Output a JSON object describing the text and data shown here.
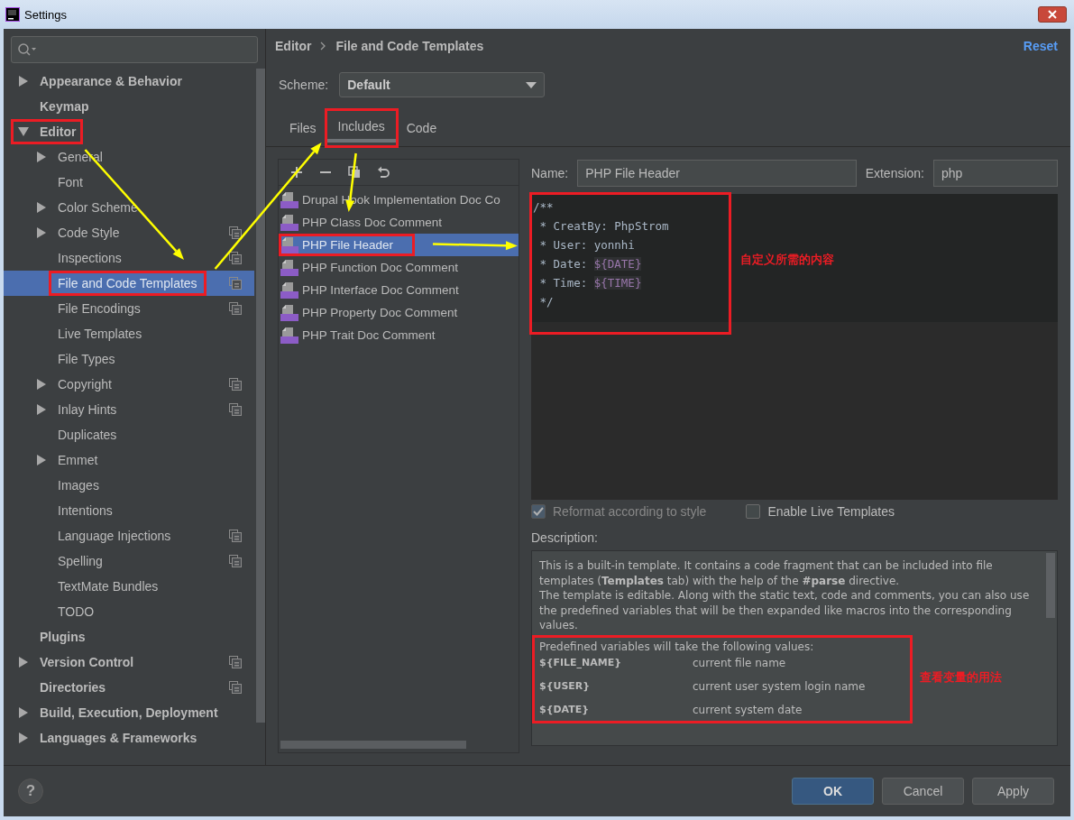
{
  "window": {
    "title": "Settings"
  },
  "sidebar": {
    "tree": [
      {
        "label": "Appearance & Behavior",
        "kind": "branch",
        "expanded": false,
        "selected": false,
        "project_level": false
      },
      {
        "label": "Keymap",
        "kind": "leaf",
        "selected": false,
        "project_level": false
      },
      {
        "label": "Editor",
        "kind": "branch",
        "expanded": true,
        "selected": false,
        "project_level": false,
        "children": [
          {
            "label": "General",
            "kind": "branch",
            "expanded": false,
            "selected": false,
            "project_level": false
          },
          {
            "label": "Font",
            "kind": "leaf",
            "selected": false,
            "project_level": false
          },
          {
            "label": "Color Scheme",
            "kind": "branch",
            "expanded": false,
            "selected": false,
            "project_level": false
          },
          {
            "label": "Code Style",
            "kind": "branch",
            "expanded": false,
            "selected": false,
            "project_level": true
          },
          {
            "label": "Inspections",
            "kind": "leaf",
            "selected": false,
            "project_level": true
          },
          {
            "label": "File and Code Templates",
            "kind": "leaf",
            "selected": true,
            "project_level": true
          },
          {
            "label": "File Encodings",
            "kind": "leaf",
            "selected": false,
            "project_level": true
          },
          {
            "label": "Live Templates",
            "kind": "leaf",
            "selected": false,
            "project_level": false
          },
          {
            "label": "File Types",
            "kind": "leaf",
            "selected": false,
            "project_level": false
          },
          {
            "label": "Copyright",
            "kind": "branch",
            "expanded": false,
            "selected": false,
            "project_level": true
          },
          {
            "label": "Inlay Hints",
            "kind": "branch",
            "expanded": false,
            "selected": false,
            "project_level": true
          },
          {
            "label": "Duplicates",
            "kind": "leaf",
            "selected": false,
            "project_level": false
          },
          {
            "label": "Emmet",
            "kind": "branch",
            "expanded": false,
            "selected": false,
            "project_level": false
          },
          {
            "label": "Images",
            "kind": "leaf",
            "selected": false,
            "project_level": false
          },
          {
            "label": "Intentions",
            "kind": "leaf",
            "selected": false,
            "project_level": false
          },
          {
            "label": "Language Injections",
            "kind": "leaf",
            "selected": false,
            "project_level": true
          },
          {
            "label": "Spelling",
            "kind": "leaf",
            "selected": false,
            "project_level": true
          },
          {
            "label": "TextMate Bundles",
            "kind": "leaf",
            "selected": false,
            "project_level": false
          },
          {
            "label": "TODO",
            "kind": "leaf",
            "selected": false,
            "project_level": false
          }
        ]
      },
      {
        "label": "Plugins",
        "kind": "leaf",
        "selected": false,
        "project_level": false
      },
      {
        "label": "Version Control",
        "kind": "branch",
        "expanded": false,
        "selected": false,
        "project_level": true
      },
      {
        "label": "Directories",
        "kind": "leaf",
        "selected": false,
        "project_level": true
      },
      {
        "label": "Build, Execution, Deployment",
        "kind": "branch",
        "expanded": false,
        "selected": false,
        "project_level": false
      },
      {
        "label": "Languages & Frameworks",
        "kind": "branch",
        "expanded": false,
        "selected": false,
        "project_level": false
      }
    ]
  },
  "breadcrumb": [
    "Editor",
    "File and Code Templates"
  ],
  "reset_link": "Reset",
  "scheme": {
    "label": "Scheme:",
    "value": "Default"
  },
  "tabs": [
    {
      "label": "Files",
      "selected": false
    },
    {
      "label": "Includes",
      "selected": true
    },
    {
      "label": "Code",
      "selected": false
    }
  ],
  "templates": [
    {
      "label": "Drupal Hook Implementation Doc Co",
      "selected": false
    },
    {
      "label": "PHP Class Doc Comment",
      "selected": false
    },
    {
      "label": "PHP File Header",
      "selected": true
    },
    {
      "label": "PHP Function Doc Comment",
      "selected": false
    },
    {
      "label": "PHP Interface Doc Comment",
      "selected": false
    },
    {
      "label": "PHP Property Doc Comment",
      "selected": false
    },
    {
      "label": "PHP Trait Doc Comment",
      "selected": false
    }
  ],
  "name_field": {
    "label": "Name:",
    "value": "PHP File Header"
  },
  "extension_field": {
    "label": "Extension:",
    "value": "php"
  },
  "code": [
    [
      {
        "text": "/**",
        "kind": "plain"
      }
    ],
    [
      {
        "text": " * CreatBy: PhpStrom",
        "kind": "plain"
      }
    ],
    [
      {
        "text": " * User: yonnhi",
        "kind": "plain"
      }
    ],
    [
      {
        "text": " * Date: ",
        "kind": "plain"
      },
      {
        "text": "${DATE}",
        "kind": "variable"
      }
    ],
    [
      {
        "text": " * Time: ",
        "kind": "plain"
      },
      {
        "text": "${TIME}",
        "kind": "variable"
      }
    ],
    [
      {
        "text": " */",
        "kind": "plain"
      }
    ]
  ],
  "options": [
    {
      "label": "Reformat according to style",
      "checked": true,
      "disabled": true
    },
    {
      "label": "Enable Live Templates",
      "checked": false,
      "disabled": false
    }
  ],
  "description": {
    "label": "Description:",
    "paragraphs": [
      "This is a built-in template. It contains a code fragment that can be included into file templates (**Templates** tab) with the help of the **#parse** directive.",
      "The template is editable. Along with the static text, code and comments, you can also use the predefined variables that will be then expanded like macros into the corresponding values."
    ],
    "variables_intro": "Predefined variables will take the following values:",
    "variables": [
      {
        "name": "${FILE_NAME}",
        "meaning": "current file name"
      },
      {
        "name": "${USER}",
        "meaning": "current user system login name"
      },
      {
        "name": "${DATE}",
        "meaning": "current system date"
      }
    ]
  },
  "help_button": "?",
  "buttons": [
    {
      "label": "OK",
      "primary": true
    },
    {
      "label": "Cancel",
      "primary": false
    },
    {
      "label": "Apply",
      "primary": false
    }
  ],
  "annotations": [
    {
      "text": "自定义所需的内容",
      "kind": "note"
    },
    {
      "text": "查看变量的用法",
      "kind": "note"
    }
  ]
}
